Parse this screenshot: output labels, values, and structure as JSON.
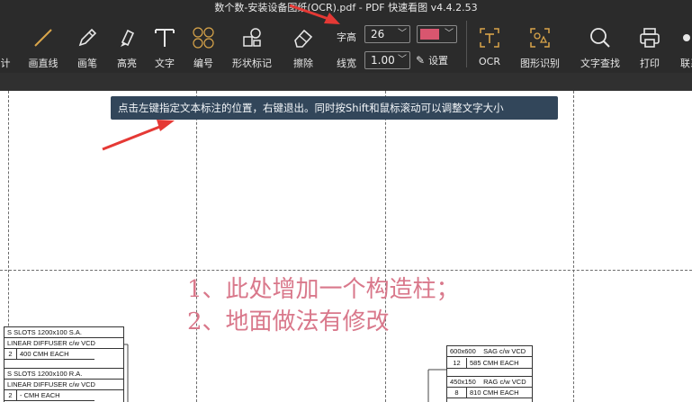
{
  "window": {
    "title": "数个数-安装设备图纸(OCR).pdf - PDF 快速看图 v4.4.2.53"
  },
  "toolbar": {
    "tools": [
      {
        "id": "count",
        "label": "计"
      },
      {
        "id": "line",
        "label": "画直线"
      },
      {
        "id": "pen",
        "label": "画笔"
      },
      {
        "id": "highlight",
        "label": "高亮"
      },
      {
        "id": "text",
        "label": "文字"
      },
      {
        "id": "number",
        "label": "编号",
        "glyph": "①②③④"
      },
      {
        "id": "shape",
        "label": "形状标记"
      },
      {
        "id": "erase",
        "label": "擦除"
      }
    ],
    "font_size_label": "字高",
    "font_size_value": "26",
    "line_width_label": "线宽",
    "line_width_value": "1.00",
    "settings_label": "设置",
    "color_value": "#d9566f",
    "tools_right": [
      {
        "id": "ocr",
        "label": "OCR"
      },
      {
        "id": "shape-recognize",
        "label": "图形识别"
      },
      {
        "id": "text-search",
        "label": "文字查找"
      },
      {
        "id": "print",
        "label": "打印"
      },
      {
        "id": "link",
        "label": "联系"
      }
    ]
  },
  "tooltip": {
    "text": "点击左键指定文本标注的位置，右键退出。同时按Shift和鼠标滚动可以调整文字大小"
  },
  "annotations": {
    "line1": "1、此处增加一个构造柱；",
    "line2": "2、地面做法有修改"
  },
  "drawing": {
    "left_table": {
      "rows": [
        {
          "text": "S SLOTS 1200x100 S.A."
        },
        {
          "text": "LINEAR DIFFUSER c/w VCD"
        },
        {
          "num": "2",
          "text": "400 CMH EACH"
        },
        {
          "text": "S SLOTS 1200x100 R.A."
        },
        {
          "text": "LINEAR DIFFUSER c/w VCD"
        },
        {
          "num": "2",
          "text": "- CMH EACH"
        }
      ]
    },
    "right_table": {
      "rows": [
        {
          "size": "600x600",
          "text": "SAG c/w VCD"
        },
        {
          "num": "12",
          "text": "585  CMH EACH"
        },
        {
          "size": "450x150",
          "text": "RAG c/w VCD"
        },
        {
          "num": "8",
          "text": "810  CMH EACH"
        }
      ]
    }
  },
  "colors": {
    "toolbar_bg": "#2b2b2b",
    "tool_icon_orange": "#d9a54a",
    "annotation_pink": "#d9788b",
    "tooltip_bg": "#32465a",
    "arrow_red": "#e53935"
  }
}
